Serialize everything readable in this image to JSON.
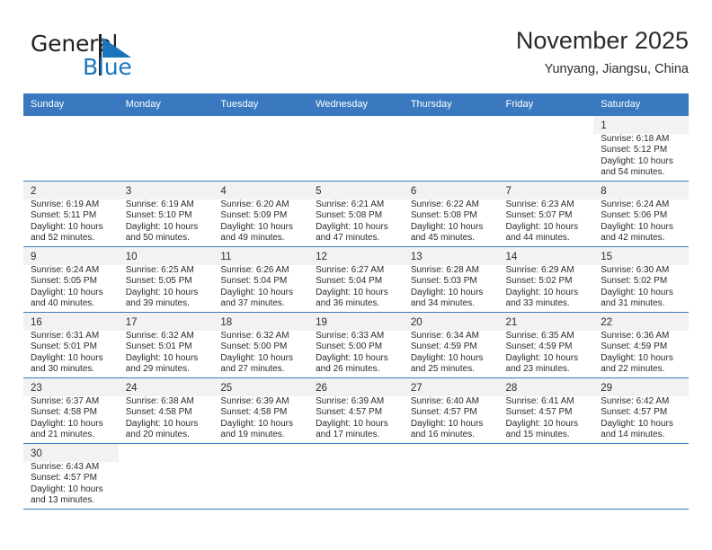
{
  "brand": {
    "name_part1": "General",
    "name_part2": "Blue",
    "flag_icon": "triangle-flag-icon",
    "colors": {
      "dark": "#231f20",
      "blue": "#1b75bb"
    }
  },
  "header": {
    "title": "November 2025",
    "subtitle": "Yunyang, Jiangsu, China"
  },
  "theme": {
    "header_bg": "#3a79bf",
    "header_text": "#ffffff",
    "shaded_cell": "#f2f2f2",
    "grid_line": "#3a79bf"
  },
  "weekdays": [
    "Sunday",
    "Monday",
    "Tuesday",
    "Wednesday",
    "Thursday",
    "Friday",
    "Saturday"
  ],
  "weeks": [
    [
      {
        "day": "",
        "sunrise": "",
        "sunset": "",
        "daylight1": "",
        "daylight2": "",
        "empty": true
      },
      {
        "day": "",
        "sunrise": "",
        "sunset": "",
        "daylight1": "",
        "daylight2": "",
        "empty": true
      },
      {
        "day": "",
        "sunrise": "",
        "sunset": "",
        "daylight1": "",
        "daylight2": "",
        "empty": true
      },
      {
        "day": "",
        "sunrise": "",
        "sunset": "",
        "daylight1": "",
        "daylight2": "",
        "empty": true
      },
      {
        "day": "",
        "sunrise": "",
        "sunset": "",
        "daylight1": "",
        "daylight2": "",
        "empty": true
      },
      {
        "day": "",
        "sunrise": "",
        "sunset": "",
        "daylight1": "",
        "daylight2": "",
        "empty": true
      },
      {
        "day": "1",
        "sunrise": "Sunrise: 6:18 AM",
        "sunset": "Sunset: 5:12 PM",
        "daylight1": "Daylight: 10 hours",
        "daylight2": "and 54 minutes.",
        "empty": false
      }
    ],
    [
      {
        "day": "2",
        "sunrise": "Sunrise: 6:19 AM",
        "sunset": "Sunset: 5:11 PM",
        "daylight1": "Daylight: 10 hours",
        "daylight2": "and 52 minutes.",
        "empty": false
      },
      {
        "day": "3",
        "sunrise": "Sunrise: 6:19 AM",
        "sunset": "Sunset: 5:10 PM",
        "daylight1": "Daylight: 10 hours",
        "daylight2": "and 50 minutes.",
        "empty": false
      },
      {
        "day": "4",
        "sunrise": "Sunrise: 6:20 AM",
        "sunset": "Sunset: 5:09 PM",
        "daylight1": "Daylight: 10 hours",
        "daylight2": "and 49 minutes.",
        "empty": false
      },
      {
        "day": "5",
        "sunrise": "Sunrise: 6:21 AM",
        "sunset": "Sunset: 5:08 PM",
        "daylight1": "Daylight: 10 hours",
        "daylight2": "and 47 minutes.",
        "empty": false
      },
      {
        "day": "6",
        "sunrise": "Sunrise: 6:22 AM",
        "sunset": "Sunset: 5:08 PM",
        "daylight1": "Daylight: 10 hours",
        "daylight2": "and 45 minutes.",
        "empty": false
      },
      {
        "day": "7",
        "sunrise": "Sunrise: 6:23 AM",
        "sunset": "Sunset: 5:07 PM",
        "daylight1": "Daylight: 10 hours",
        "daylight2": "and 44 minutes.",
        "empty": false
      },
      {
        "day": "8",
        "sunrise": "Sunrise: 6:24 AM",
        "sunset": "Sunset: 5:06 PM",
        "daylight1": "Daylight: 10 hours",
        "daylight2": "and 42 minutes.",
        "empty": false
      }
    ],
    [
      {
        "day": "9",
        "sunrise": "Sunrise: 6:24 AM",
        "sunset": "Sunset: 5:05 PM",
        "daylight1": "Daylight: 10 hours",
        "daylight2": "and 40 minutes.",
        "empty": false
      },
      {
        "day": "10",
        "sunrise": "Sunrise: 6:25 AM",
        "sunset": "Sunset: 5:05 PM",
        "daylight1": "Daylight: 10 hours",
        "daylight2": "and 39 minutes.",
        "empty": false
      },
      {
        "day": "11",
        "sunrise": "Sunrise: 6:26 AM",
        "sunset": "Sunset: 5:04 PM",
        "daylight1": "Daylight: 10 hours",
        "daylight2": "and 37 minutes.",
        "empty": false
      },
      {
        "day": "12",
        "sunrise": "Sunrise: 6:27 AM",
        "sunset": "Sunset: 5:04 PM",
        "daylight1": "Daylight: 10 hours",
        "daylight2": "and 36 minutes.",
        "empty": false
      },
      {
        "day": "13",
        "sunrise": "Sunrise: 6:28 AM",
        "sunset": "Sunset: 5:03 PM",
        "daylight1": "Daylight: 10 hours",
        "daylight2": "and 34 minutes.",
        "empty": false
      },
      {
        "day": "14",
        "sunrise": "Sunrise: 6:29 AM",
        "sunset": "Sunset: 5:02 PM",
        "daylight1": "Daylight: 10 hours",
        "daylight2": "and 33 minutes.",
        "empty": false
      },
      {
        "day": "15",
        "sunrise": "Sunrise: 6:30 AM",
        "sunset": "Sunset: 5:02 PM",
        "daylight1": "Daylight: 10 hours",
        "daylight2": "and 31 minutes.",
        "empty": false
      }
    ],
    [
      {
        "day": "16",
        "sunrise": "Sunrise: 6:31 AM",
        "sunset": "Sunset: 5:01 PM",
        "daylight1": "Daylight: 10 hours",
        "daylight2": "and 30 minutes.",
        "empty": false
      },
      {
        "day": "17",
        "sunrise": "Sunrise: 6:32 AM",
        "sunset": "Sunset: 5:01 PM",
        "daylight1": "Daylight: 10 hours",
        "daylight2": "and 29 minutes.",
        "empty": false
      },
      {
        "day": "18",
        "sunrise": "Sunrise: 6:32 AM",
        "sunset": "Sunset: 5:00 PM",
        "daylight1": "Daylight: 10 hours",
        "daylight2": "and 27 minutes.",
        "empty": false
      },
      {
        "day": "19",
        "sunrise": "Sunrise: 6:33 AM",
        "sunset": "Sunset: 5:00 PM",
        "daylight1": "Daylight: 10 hours",
        "daylight2": "and 26 minutes.",
        "empty": false
      },
      {
        "day": "20",
        "sunrise": "Sunrise: 6:34 AM",
        "sunset": "Sunset: 4:59 PM",
        "daylight1": "Daylight: 10 hours",
        "daylight2": "and 25 minutes.",
        "empty": false
      },
      {
        "day": "21",
        "sunrise": "Sunrise: 6:35 AM",
        "sunset": "Sunset: 4:59 PM",
        "daylight1": "Daylight: 10 hours",
        "daylight2": "and 23 minutes.",
        "empty": false
      },
      {
        "day": "22",
        "sunrise": "Sunrise: 6:36 AM",
        "sunset": "Sunset: 4:59 PM",
        "daylight1": "Daylight: 10 hours",
        "daylight2": "and 22 minutes.",
        "empty": false
      }
    ],
    [
      {
        "day": "23",
        "sunrise": "Sunrise: 6:37 AM",
        "sunset": "Sunset: 4:58 PM",
        "daylight1": "Daylight: 10 hours",
        "daylight2": "and 21 minutes.",
        "empty": false
      },
      {
        "day": "24",
        "sunrise": "Sunrise: 6:38 AM",
        "sunset": "Sunset: 4:58 PM",
        "daylight1": "Daylight: 10 hours",
        "daylight2": "and 20 minutes.",
        "empty": false
      },
      {
        "day": "25",
        "sunrise": "Sunrise: 6:39 AM",
        "sunset": "Sunset: 4:58 PM",
        "daylight1": "Daylight: 10 hours",
        "daylight2": "and 19 minutes.",
        "empty": false
      },
      {
        "day": "26",
        "sunrise": "Sunrise: 6:39 AM",
        "sunset": "Sunset: 4:57 PM",
        "daylight1": "Daylight: 10 hours",
        "daylight2": "and 17 minutes.",
        "empty": false
      },
      {
        "day": "27",
        "sunrise": "Sunrise: 6:40 AM",
        "sunset": "Sunset: 4:57 PM",
        "daylight1": "Daylight: 10 hours",
        "daylight2": "and 16 minutes.",
        "empty": false
      },
      {
        "day": "28",
        "sunrise": "Sunrise: 6:41 AM",
        "sunset": "Sunset: 4:57 PM",
        "daylight1": "Daylight: 10 hours",
        "daylight2": "and 15 minutes.",
        "empty": false
      },
      {
        "day": "29",
        "sunrise": "Sunrise: 6:42 AM",
        "sunset": "Sunset: 4:57 PM",
        "daylight1": "Daylight: 10 hours",
        "daylight2": "and 14 minutes.",
        "empty": false
      }
    ],
    [
      {
        "day": "30",
        "sunrise": "Sunrise: 6:43 AM",
        "sunset": "Sunset: 4:57 PM",
        "daylight1": "Daylight: 10 hours",
        "daylight2": "and 13 minutes.",
        "empty": false
      },
      {
        "day": "",
        "sunrise": "",
        "sunset": "",
        "daylight1": "",
        "daylight2": "",
        "empty": true
      },
      {
        "day": "",
        "sunrise": "",
        "sunset": "",
        "daylight1": "",
        "daylight2": "",
        "empty": true
      },
      {
        "day": "",
        "sunrise": "",
        "sunset": "",
        "daylight1": "",
        "daylight2": "",
        "empty": true
      },
      {
        "day": "",
        "sunrise": "",
        "sunset": "",
        "daylight1": "",
        "daylight2": "",
        "empty": true
      },
      {
        "day": "",
        "sunrise": "",
        "sunset": "",
        "daylight1": "",
        "daylight2": "",
        "empty": true
      },
      {
        "day": "",
        "sunrise": "",
        "sunset": "",
        "daylight1": "",
        "daylight2": "",
        "empty": true
      }
    ]
  ]
}
